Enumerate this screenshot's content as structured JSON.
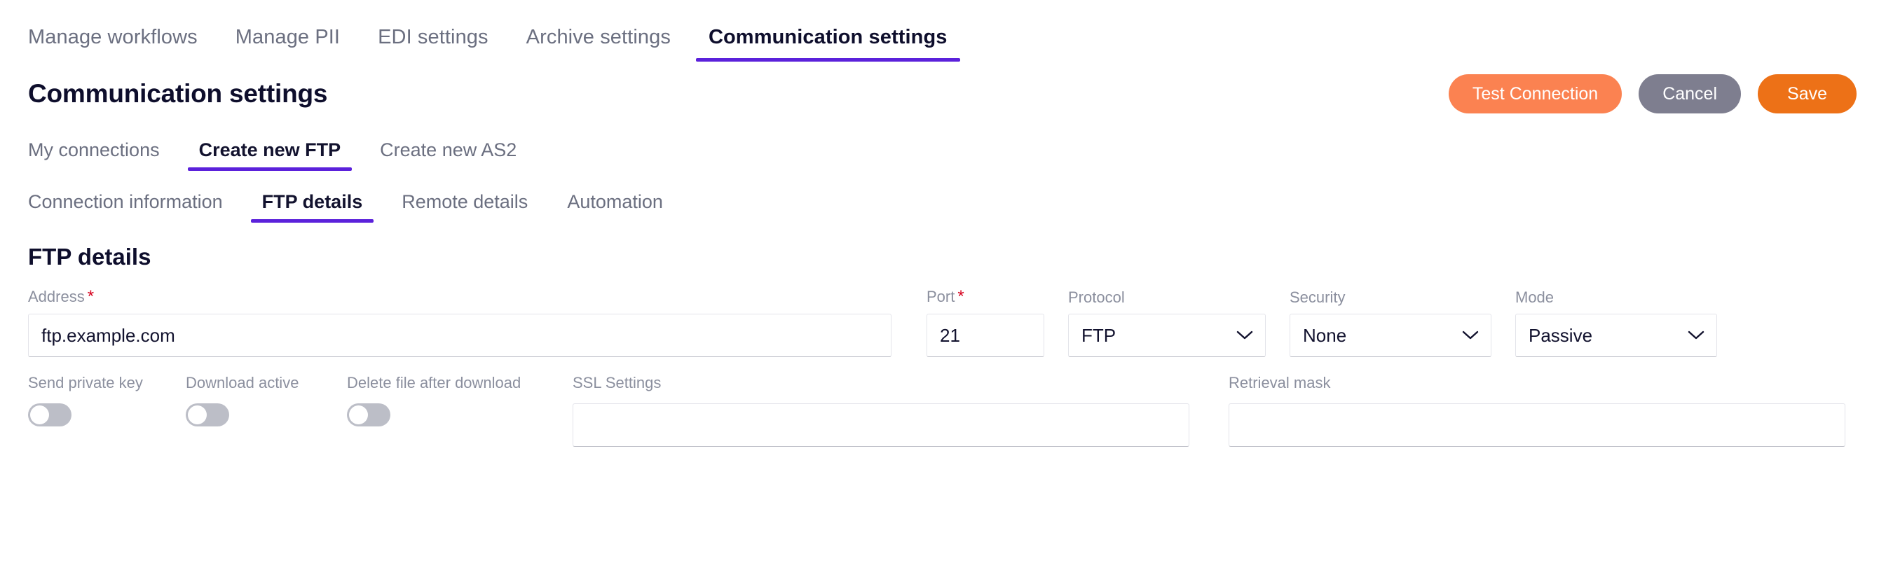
{
  "top_nav": {
    "items": [
      {
        "label": "Manage workflows",
        "active": false
      },
      {
        "label": "Manage PII",
        "active": false
      },
      {
        "label": "EDI settings",
        "active": false
      },
      {
        "label": "Archive settings",
        "active": false
      },
      {
        "label": "Communication settings",
        "active": true
      }
    ]
  },
  "header": {
    "title": "Communication settings",
    "buttons": {
      "test_connection": "Test Connection",
      "cancel": "Cancel",
      "save": "Save"
    }
  },
  "sub_nav": {
    "items": [
      {
        "label": "My connections",
        "active": false
      },
      {
        "label": "Create new FTP",
        "active": true
      },
      {
        "label": "Create new AS2",
        "active": false
      }
    ]
  },
  "section_nav": {
    "items": [
      {
        "label": "Connection information",
        "active": false
      },
      {
        "label": "FTP details",
        "active": true
      },
      {
        "label": "Remote details",
        "active": false
      },
      {
        "label": "Automation",
        "active": false
      }
    ]
  },
  "form": {
    "heading": "FTP details",
    "address": {
      "label": "Address",
      "required": "*",
      "value": "ftp.example.com",
      "placeholder": ""
    },
    "port": {
      "label": "Port",
      "required": "*",
      "value": "21",
      "placeholder": ""
    },
    "protocol": {
      "label": "Protocol",
      "value": "FTP",
      "options": [
        "FTP"
      ]
    },
    "security": {
      "label": "Security",
      "value": "None",
      "options": [
        "None"
      ]
    },
    "mode": {
      "label": "Mode",
      "value": "Passive",
      "options": [
        "Passive"
      ]
    },
    "send_private_key": {
      "label": "Send private key",
      "on": false
    },
    "download_active": {
      "label": "Download active",
      "on": false
    },
    "delete_after_download": {
      "label": "Delete file after download",
      "on": false
    },
    "ssl_settings": {
      "label": "SSL Settings",
      "value": "",
      "placeholder": ""
    },
    "retrieval_mask": {
      "label": "Retrieval mask",
      "value": "",
      "placeholder": ""
    }
  },
  "colors": {
    "accent_purple": "#5b21db",
    "test_orange": "#fb8251",
    "save_orange": "#ed7117",
    "cancel_gray": "#7e7e8f",
    "required_red": "#d5001c",
    "title_navy": "#0e0e2c"
  }
}
